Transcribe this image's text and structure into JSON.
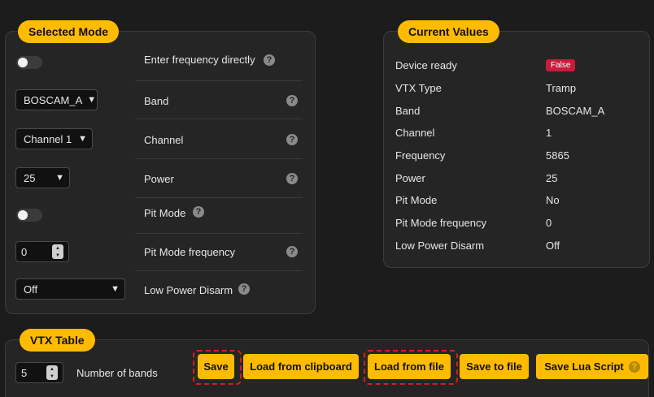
{
  "selected_mode": {
    "title": "Selected Mode",
    "rows": {
      "freq_direct": "Enter frequency directly",
      "band": "Band",
      "channel": "Channel",
      "power": "Power",
      "pit_mode": "Pit Mode",
      "pit_mode_freq": "Pit Mode frequency",
      "low_power_disarm": "Low Power Disarm"
    },
    "band_value": "BOSCAM_A",
    "channel_value": "Channel 1",
    "power_value": "25",
    "pit_freq_value": "0",
    "lpd_value": "Off",
    "freq_direct_on": false,
    "pit_mode_on": false
  },
  "current_values": {
    "title": "Current Values",
    "device_ready_label": "Device ready",
    "device_ready_badge": "False",
    "items": [
      {
        "label": "VTX Type",
        "value": "Tramp"
      },
      {
        "label": "Band",
        "value": "BOSCAM_A"
      },
      {
        "label": "Channel",
        "value": "1"
      },
      {
        "label": "Frequency",
        "value": "5865"
      },
      {
        "label": "Power",
        "value": "25"
      },
      {
        "label": "Pit Mode",
        "value": "No"
      },
      {
        "label": "Pit Mode frequency",
        "value": "0"
      },
      {
        "label": "Low Power Disarm",
        "value": "Off"
      }
    ]
  },
  "vtx_table": {
    "title": "VTX Table",
    "bands_value": "5",
    "bands_label": "Number of bands"
  },
  "buttons": {
    "save": "Save",
    "load_clipboard": "Load from clipboard",
    "load_file": "Load from file",
    "save_file": "Save to file",
    "save_lua": "Save Lua Script"
  },
  "icons": {
    "help": "question-circle-icon",
    "dropdown": "chevron-down-icon"
  },
  "colors": {
    "accent": "#ffbb00",
    "badge_false": "#c91c3b",
    "highlight": "#d42020"
  }
}
